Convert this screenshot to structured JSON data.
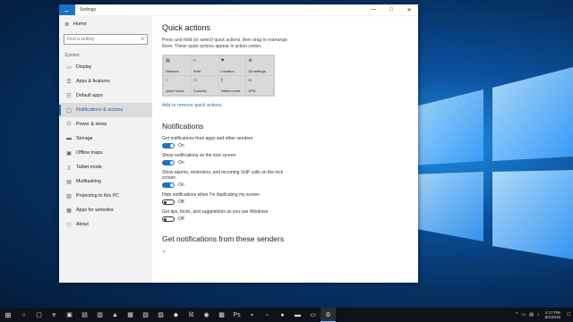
{
  "window": {
    "title": "Settings",
    "back_icon": "←",
    "controls": [
      "—",
      "□",
      "✕"
    ]
  },
  "sidebar": {
    "home_label": "Home",
    "search_placeholder": "Find a setting",
    "section": "System",
    "items": [
      {
        "label": "Display",
        "icon": "▭"
      },
      {
        "label": "Apps & features",
        "icon": "☰"
      },
      {
        "label": "Default apps",
        "icon": "☷"
      },
      {
        "label": "Notifications & actions",
        "icon": "▢",
        "active": true
      },
      {
        "label": "Power & sleep",
        "icon": "⏻"
      },
      {
        "label": "Storage",
        "icon": "▬"
      },
      {
        "label": "Offline maps",
        "icon": "▣"
      },
      {
        "label": "Tablet mode",
        "icon": "▯"
      },
      {
        "label": "Multitasking",
        "icon": "▤"
      },
      {
        "label": "Projecting to this PC",
        "icon": "▥"
      },
      {
        "label": "Apps for websites",
        "icon": "▦"
      },
      {
        "label": "About",
        "icon": "ⓘ"
      }
    ]
  },
  "quick_actions": {
    "heading": "Quick actions",
    "description": "Press and hold (or select) quick actions, then drag to rearrange them. These quick actions appear in action center.",
    "tiles": [
      {
        "label": "Network",
        "icon": "▤"
      },
      {
        "label": "Note",
        "icon": "□"
      },
      {
        "label": "Location",
        "icon": "⚑"
      },
      {
        "label": "All settings",
        "icon": "⚙"
      },
      {
        "label": "Quiet hours",
        "icon": "☾"
      },
      {
        "label": "Connect",
        "icon": "▭"
      },
      {
        "label": "Tablet mode",
        "icon": "▯"
      },
      {
        "label": "VPN",
        "icon": "∞"
      }
    ],
    "link": "Add or remove quick actions"
  },
  "notifications": {
    "heading": "Notifications",
    "settings": [
      {
        "label": "Get notifications from apps and other senders",
        "state": "On",
        "on": true
      },
      {
        "label": "Show notifications on the lock screen",
        "state": "On",
        "on": true
      },
      {
        "label": "Show alarms, reminders, and incoming VoIP calls on the lock screen",
        "state": "On",
        "on": true
      },
      {
        "label": "Hide notifications when I'm duplicating my screen",
        "state": "Off",
        "on": false
      },
      {
        "label": "Get tips, tricks, and suggestions as you use Windows",
        "state": "Off",
        "on": false
      }
    ]
  },
  "senders": {
    "heading": "Get notifications from these senders",
    "loading_icon": "∘"
  },
  "taskbar": {
    "start_icon": "⊞",
    "icons": [
      "○",
      "▢",
      "e",
      "▣",
      "▤",
      "▥",
      "▲",
      "▦",
      "▧",
      "▨",
      "◆",
      "☒",
      "◉",
      "▩",
      "Ps",
      "▪",
      "▫",
      "●",
      "▬",
      "▭",
      "⚙"
    ],
    "active_index": 20,
    "tray": [
      "^",
      "▭",
      "▤",
      "♪"
    ],
    "time": "4:17 PM",
    "date": "8/1/2016",
    "notification_icon": "□"
  }
}
